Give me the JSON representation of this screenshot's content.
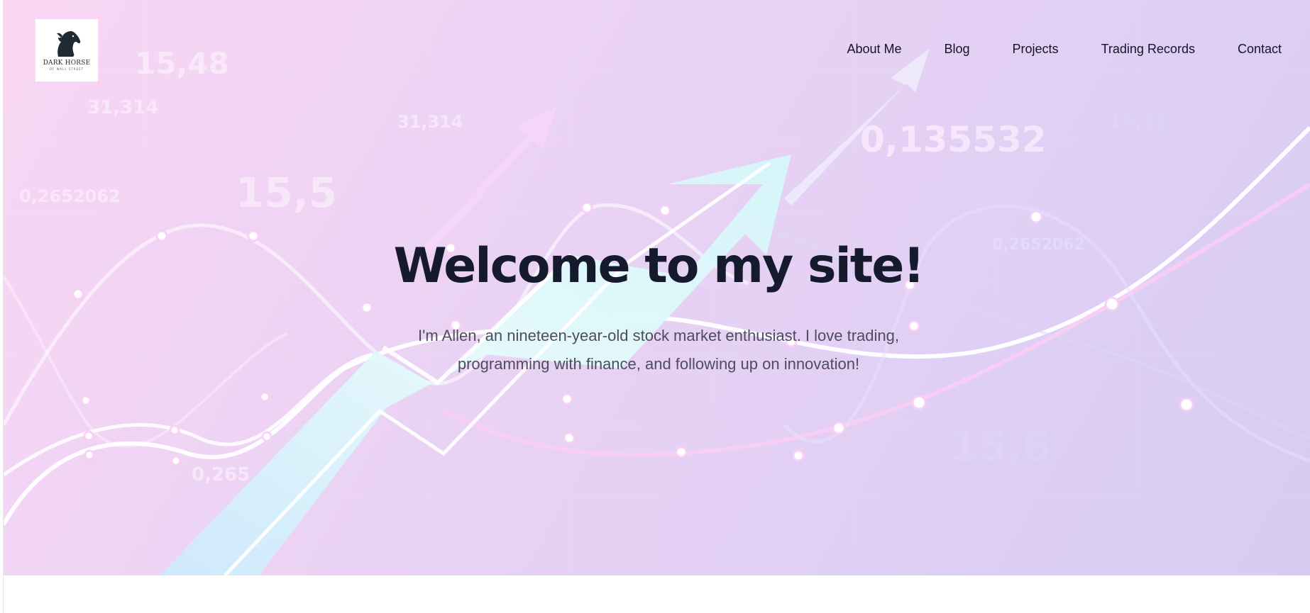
{
  "logo": {
    "name": "DARK HORSE",
    "tagline": "OF WALL STREET",
    "icon": "horse-head-icon"
  },
  "nav": {
    "items": [
      {
        "label": "About Me"
      },
      {
        "label": "Blog"
      },
      {
        "label": "Projects"
      },
      {
        "label": "Trading Records"
      },
      {
        "label": "Contact"
      }
    ]
  },
  "hero": {
    "title": "Welcome to my site!",
    "subtitle_line1": "I'm Allen, an nineteen-year-old stock market enthusiast. I love trading,",
    "subtitle_line2": "programming with finance, and following up on innovation!",
    "background_numbers": [
      "15,48",
      "31,314",
      "31,314",
      "0,2652062",
      "15,5",
      "0,135532",
      "16,21",
      "0,2652062",
      "15,6",
      "0,265"
    ]
  },
  "colors": {
    "hero_gradient_start": "#f9d6f4",
    "hero_gradient_end": "#d6ccf2",
    "title": "#151a2c",
    "subtitle": "#4d4d5e",
    "nav_text": "#141428",
    "arrow": "#dff7fb"
  }
}
